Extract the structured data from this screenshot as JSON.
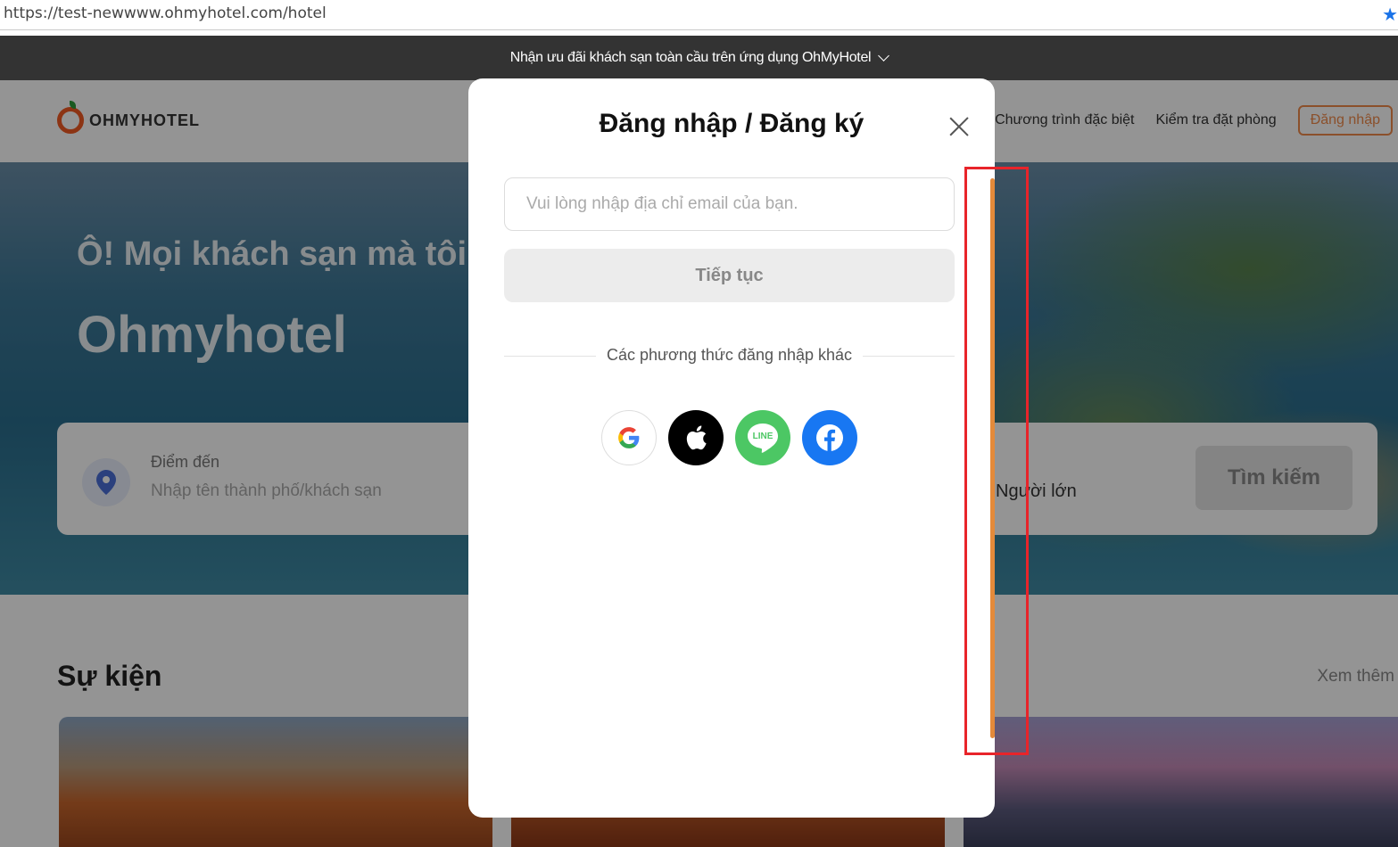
{
  "browser": {
    "url": "https://test-newwww.ohmyhotel.com/hotel",
    "bookmark_icon": "star-icon"
  },
  "promo_bar": {
    "text": "Nhận ưu đãi khách sạn toàn cầu trên ứng dụng OhMyHotel",
    "toggle_icon": "chevron-down-icon",
    "background": "#333333"
  },
  "header": {
    "logo_text": "OHMYHOTEL",
    "nav": [
      "Chương trình đặc biệt",
      "Kiểm tra đặt phòng"
    ],
    "login_label": "Đăng nhập",
    "accent": "#f08a4b"
  },
  "hero": {
    "subtitle": "Ô! Mọi khách sạn mà tôi",
    "title": "Ohmyhotel",
    "search": {
      "destination_label": "Điểm đến",
      "destination_placeholder": "Nhập tên thành phố/khách sạn",
      "guests_value": "Người lớn",
      "search_button": "Tìm kiếm"
    }
  },
  "events": {
    "title": "Sự kiện",
    "more_link": "Xem thêm"
  },
  "modal": {
    "title": "Đăng nhập / Đăng ký",
    "close_icon": "close-icon",
    "email_placeholder": "Vui lòng nhập địa chỉ email của bạn.",
    "email_value": "",
    "continue_label": "Tiếp tục",
    "divider_text": "Các phương thức đăng nhập khác",
    "social_logins": [
      {
        "name": "google",
        "icon": "google-icon",
        "color": "#ffffff"
      },
      {
        "name": "apple",
        "icon": "apple-icon",
        "color": "#000000"
      },
      {
        "name": "line",
        "icon": "line-icon",
        "label": "LINE",
        "color": "#4cc764"
      },
      {
        "name": "facebook",
        "icon": "facebook-icon",
        "color": "#1877f2"
      }
    ],
    "scrollbar_color": "#e48a3a"
  },
  "annotation": {
    "highlight_color": "#e8242a"
  }
}
